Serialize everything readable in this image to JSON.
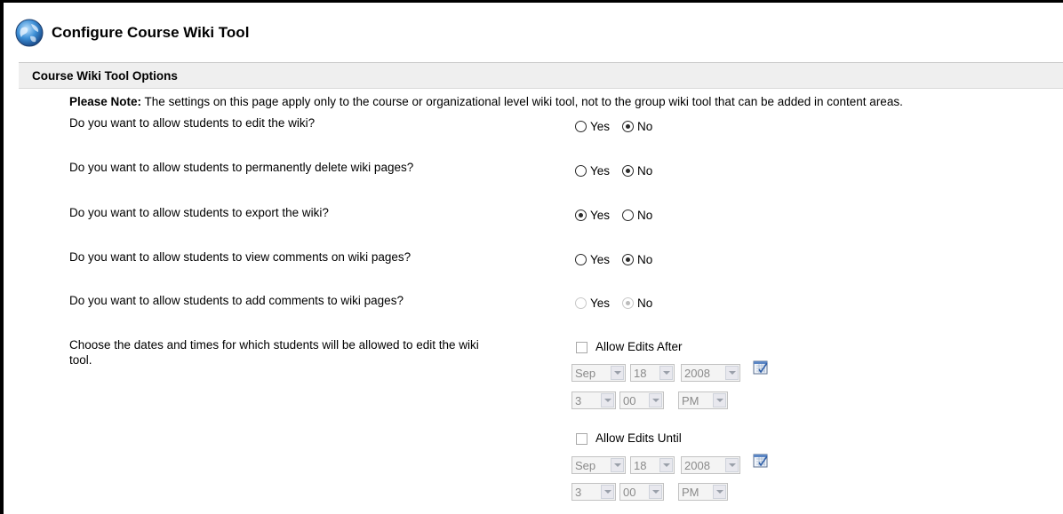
{
  "header": {
    "title": "Configure Course Wiki Tool",
    "icon": "globe-icon"
  },
  "options": {
    "title": "Course Wiki Tool Options"
  },
  "note": {
    "label": "Please Note:",
    "text": " The settings on this page apply only to the course or organizational level wiki tool, not to the group wiki tool that can be added in content areas."
  },
  "questions": [
    {
      "text": "Do you want to allow students to edit the wiki?",
      "yes": "Yes",
      "no": "No",
      "selected": "No",
      "enabled": true
    },
    {
      "text": "Do you want to allow students to permanently delete wiki pages?",
      "yes": "Yes",
      "no": "No",
      "selected": "No",
      "enabled": true
    },
    {
      "text": "Do you want to allow students to export the wiki?",
      "yes": "Yes",
      "no": "No",
      "selected": "Yes",
      "enabled": true
    },
    {
      "text": "Do you want to allow students to view comments on wiki pages?",
      "yes": "Yes",
      "no": "No",
      "selected": "No",
      "enabled": true
    },
    {
      "text": "Do you want to allow students to add comments to wiki pages?",
      "yes": "Yes",
      "no": "No",
      "selected": "No",
      "enabled": false
    }
  ],
  "dates": {
    "prompt_line1": "Choose the dates and times for which students will be allowed to edit the wiki",
    "prompt_line2": "tool.",
    "after": {
      "label": "Allow Edits After",
      "checked": false,
      "month": "Sep",
      "day": "18",
      "year": "2008",
      "hour": "3",
      "minute": "00",
      "ampm": "PM"
    },
    "until": {
      "label": "Allow Edits Until",
      "checked": false,
      "month": "Sep",
      "day": "18",
      "year": "2008",
      "hour": "3",
      "minute": "00",
      "ampm": "PM"
    }
  }
}
